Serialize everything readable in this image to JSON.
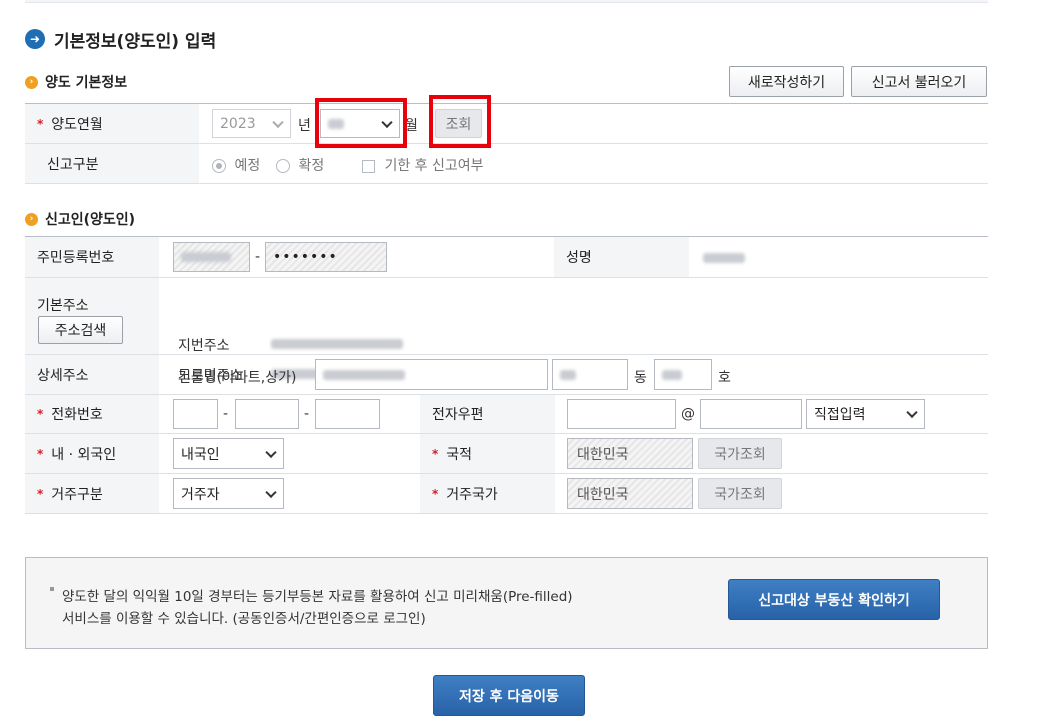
{
  "page": {
    "title": "기본정보(양도인) 입력"
  },
  "section_transfer": {
    "title": "양도 기본정보",
    "new_button": "새로작성하기",
    "load_button": "신고서 불러오기",
    "year_label": "양도연월",
    "year_value": "2023",
    "year_unit": "년",
    "month_unit": "월",
    "lookup_button": "조회",
    "report_type_label": "신고구분",
    "radio_expected": "예정",
    "radio_confirmed": "확정",
    "checkbox_late": "기한 후 신고여부"
  },
  "section_reporter": {
    "title": "신고인(양도인)",
    "rrn_label": "주민등록번호",
    "rrn_sep": "-",
    "rrn_back": "•••••••",
    "name_label": "성명",
    "address_label": "기본주소",
    "address_search_button": "주소검색",
    "lot_address_label": "지번주소",
    "road_address_label": "도로명주소",
    "detail_address_label": "상세주소",
    "building_label": "건물명(아파트,상가)",
    "dong_unit": "동",
    "ho_unit": "호",
    "phone_label": "전화번호",
    "phone_sep1": "-",
    "phone_sep2": "-",
    "email_label": "전자우편",
    "email_at": "@",
    "email_domain_select": "직접입력",
    "nationality_type_label": "내 · 외국인",
    "nationality_type_value": "내국인",
    "nationality_label": "국적",
    "nationality_value": "대한민국",
    "country_lookup_button": "국가조회",
    "residence_type_label": "거주구분",
    "residence_type_value": "거주자",
    "residence_country_label": "거주국가",
    "residence_country_value": "대한민국",
    "country_lookup_button2": "국가조회"
  },
  "notice": {
    "line1": "양도한 달의 익익월 10일 경부터는 등기부등본 자료를 활용하여 신고 미리채움(Pre-filled)",
    "line2": "서비스를 이용할 수 있습니다. (공동인증서/간편인증으로 로그인)",
    "check_button": "신고대상 부동산 확인하기"
  },
  "footer": {
    "save_next_button": "저장 후 다음이동"
  },
  "colors": {
    "primary": "#2862a8",
    "required": "#d0202a",
    "highlight": "#e8000b",
    "accent": "#f0a020"
  }
}
